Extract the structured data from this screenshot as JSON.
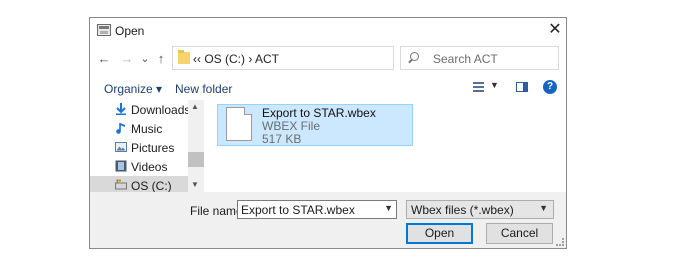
{
  "window": {
    "title": "Open",
    "close_glyph": "✕"
  },
  "nav": {
    "back_glyph": "←",
    "forward_glyph": "→",
    "recent_glyph": "⌄",
    "up_glyph": "↑",
    "address": "‹‹  OS (C:)  ›  ACT",
    "refresh_glyph": "↻",
    "search_placeholder": "Search ACT"
  },
  "toolbar": {
    "organize": "Organize ▾",
    "new_folder": "New folder",
    "help_glyph": "?"
  },
  "sidebar": {
    "items": [
      {
        "label": "Downloads",
        "icon": "download-icon"
      },
      {
        "label": "Music",
        "icon": "music-icon"
      },
      {
        "label": "Pictures",
        "icon": "pictures-icon"
      },
      {
        "label": "Videos",
        "icon": "videos-icon"
      },
      {
        "label": "OS (C:)",
        "icon": "drive-icon",
        "selected": true
      }
    ]
  },
  "files": [
    {
      "name": "Export to STAR.wbex",
      "type": "WBEX File",
      "size": "517 KB",
      "selected": true
    }
  ],
  "footer": {
    "file_name_label": "File name:",
    "file_name_value": "Export to STAR.wbex",
    "file_type_value": "Wbex files (*.wbex)",
    "open_label": "Open",
    "cancel_label": "Cancel"
  },
  "colors": {
    "accent": "#0078d7",
    "selection": "#cce8ff",
    "link": "#1f3f74"
  }
}
